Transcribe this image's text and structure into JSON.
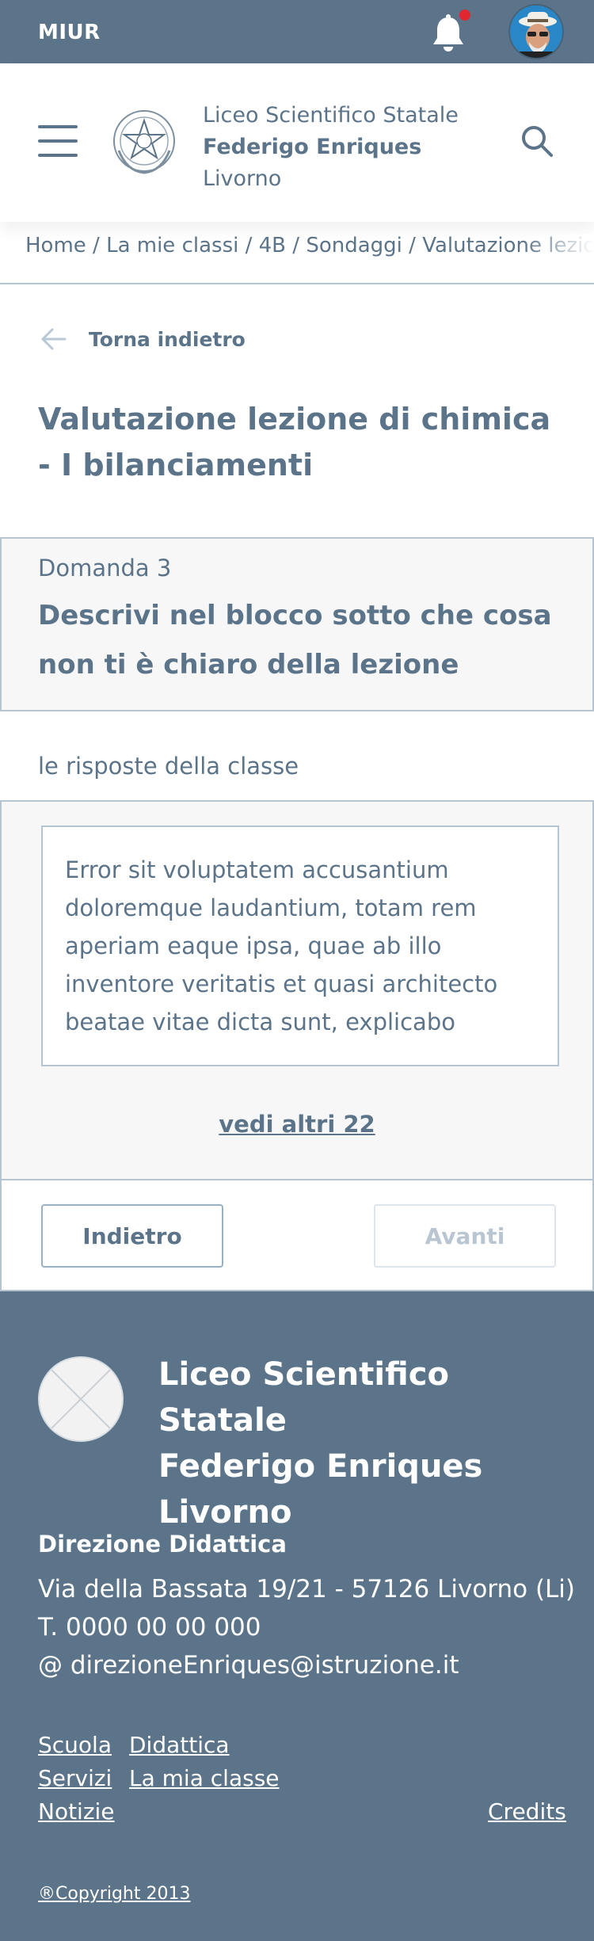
{
  "topbar": {
    "brand": "MIUR",
    "notification_icon": "bell-icon",
    "has_notification": true,
    "avatar": "user-avatar"
  },
  "header": {
    "school_line1": "Liceo Scientifico Statale",
    "school_line2": "Federigo Enriques",
    "school_line3": "Livorno",
    "menu_icon": "hamburger-icon",
    "search_icon": "search-icon"
  },
  "breadcrumb": {
    "items": [
      "Home",
      "La mie classi",
      "4B",
      "Sondaggi",
      "Valutazione lezione di chimica - I bilanciamenti"
    ],
    "separator": " / "
  },
  "back": {
    "label": "Torna indietro"
  },
  "page_title": "Valutazione lezione di chimica - I bilanciamenti",
  "question": {
    "number_label": "Domanda 3",
    "text": "Descrivi nel blocco sotto che cosa non ti è chiaro della lezione"
  },
  "answers": {
    "label": "le risposte della classe",
    "items": [
      "Error sit voluptatem accusantium doloremque laudantium, totam rem aperiam eaque ipsa, quae ab illo inventore veritatis et quasi architecto beatae vitae dicta sunt, explicabo"
    ],
    "more_link": "vedi altri 22"
  },
  "navigation": {
    "prev_label": "Indietro",
    "next_label": "Avanti",
    "next_disabled": true
  },
  "footer": {
    "school_line1": "Liceo Scientifico Statale",
    "school_line2": "Federigo Enriques",
    "school_line3": "Livorno",
    "office_title": "Direzione Didattica",
    "address": "Via della Bassata 19/21 - 57126 Livorno (Li)",
    "phone": "T. 0000 00 00 000",
    "email": "@ direzioneEnriques@istruzione.it",
    "links": {
      "scuola": "Scuola",
      "didattica": "Didattica",
      "servizi": "Servizi",
      "la_mia_classe": "La mia classe",
      "notizie": "Notizie",
      "credits": "Credits"
    },
    "copyright": "®Copyright 2013"
  },
  "colors": {
    "primary": "#5c7489",
    "border": "#b6c4d1",
    "panel_bg": "#f7f7f7",
    "notification": "#e0262f"
  }
}
